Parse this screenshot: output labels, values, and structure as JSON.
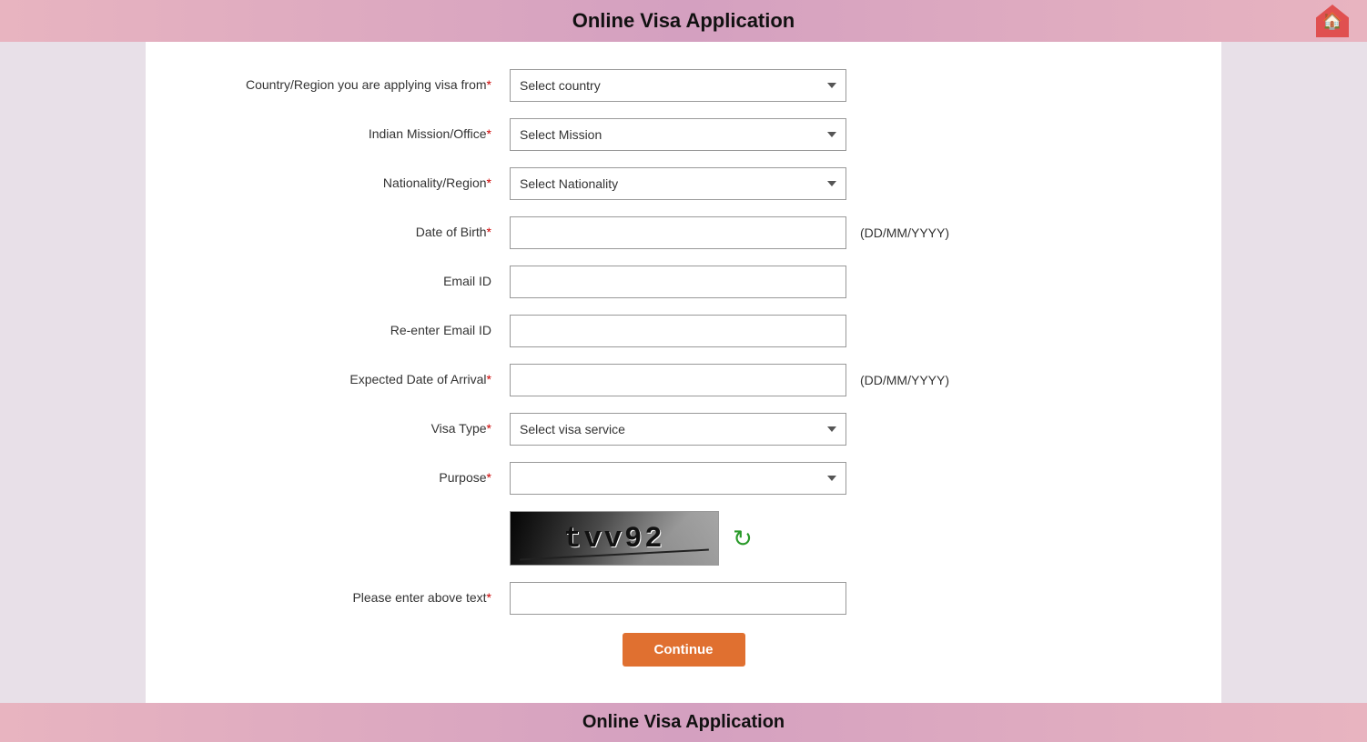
{
  "header": {
    "title": "Online Visa Application",
    "home_icon": "🏠"
  },
  "form": {
    "fields": [
      {
        "label": "Country/Region you are applying visa from",
        "required": true,
        "type": "select",
        "placeholder": "Select country",
        "name": "country-region-select",
        "hint": ""
      },
      {
        "label": "Indian Mission/Office",
        "required": true,
        "type": "select",
        "placeholder": "Select Mission",
        "name": "mission-select",
        "hint": ""
      },
      {
        "label": "Nationality/Region",
        "required": true,
        "type": "select",
        "placeholder": "Select Nationality",
        "name": "nationality-select",
        "hint": ""
      },
      {
        "label": "Date of Birth",
        "required": true,
        "type": "text",
        "placeholder": "",
        "name": "dob-input",
        "hint": "(DD/MM/YYYY)"
      },
      {
        "label": "Email ID",
        "required": false,
        "type": "text",
        "placeholder": "",
        "name": "email-input",
        "hint": ""
      },
      {
        "label": "Re-enter Email ID",
        "required": false,
        "type": "text",
        "placeholder": "",
        "name": "re-email-input",
        "hint": ""
      },
      {
        "label": "Expected Date of Arrival",
        "required": true,
        "type": "text",
        "placeholder": "",
        "name": "arrival-date-input",
        "hint": "(DD/MM/YYYY)"
      },
      {
        "label": "Visa Type",
        "required": true,
        "type": "select",
        "placeholder": "Select visa service",
        "name": "visa-type-select",
        "hint": ""
      },
      {
        "label": "Purpose",
        "required": true,
        "type": "select",
        "placeholder": "",
        "name": "purpose-select",
        "hint": ""
      }
    ],
    "captcha_text": "tvv92",
    "captcha_label": "Please enter above text",
    "captcha_required": true,
    "continue_button": "Continue"
  },
  "footer": {
    "title": "Online Visa Application"
  }
}
